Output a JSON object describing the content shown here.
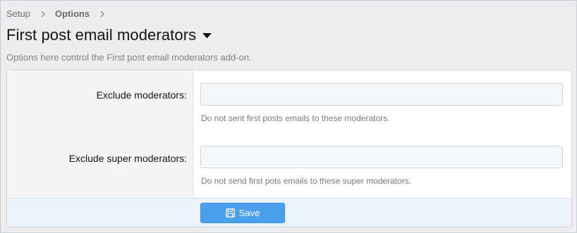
{
  "breadcrumb": {
    "items": [
      "Setup",
      "Options"
    ],
    "separator_icon": "chevron-right-icon"
  },
  "page": {
    "title": "First post email moderators",
    "title_menu_icon": "caret-down-icon",
    "description": "Options here control the First post email moderators add-on."
  },
  "form": {
    "rows": [
      {
        "label": "Exclude moderators:",
        "value": "",
        "hint": "Do not sent first posts emails to these moderators."
      },
      {
        "label": "Exclude super moderators:",
        "value": "",
        "hint": "Do not send first pots emails to these super moderators."
      }
    ],
    "save_label": "Save",
    "save_icon": "save-icon"
  },
  "colors": {
    "accent": "#4aa0ec",
    "footer_bg": "#eaf2fb",
    "label_column_bg": "#f5f5f6"
  }
}
